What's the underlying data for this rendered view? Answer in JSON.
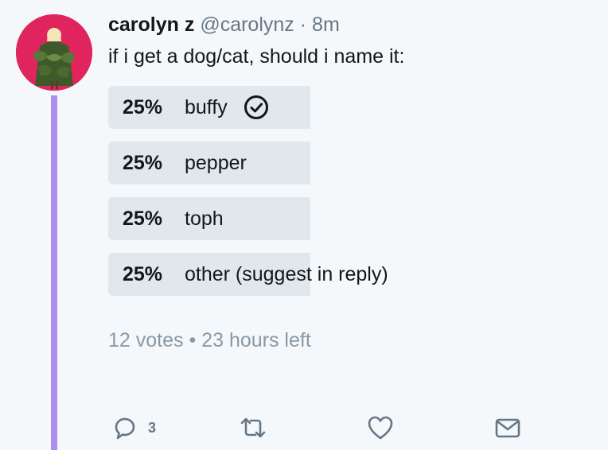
{
  "tweet": {
    "author_name": "carolyn z",
    "author_handle": "@carolynz",
    "separator": "·",
    "time": "8m",
    "text": "if i get a dog/cat, should i name it:"
  },
  "poll": {
    "options": [
      {
        "percent_label": "25%",
        "value": 0.25,
        "label": "buffy",
        "selected": true
      },
      {
        "percent_label": "25%",
        "value": 0.25,
        "label": "pepper",
        "selected": false
      },
      {
        "percent_label": "25%",
        "value": 0.25,
        "label": "toph",
        "selected": false
      },
      {
        "percent_label": "25%",
        "value": 0.25,
        "label": "other (suggest in reply)",
        "selected": false
      }
    ],
    "votes": "12 votes",
    "meta_separator": "•",
    "time_left": "23 hours left"
  },
  "actions": {
    "reply_icon": "reply-icon",
    "reply_count": "3",
    "retweet_icon": "retweet-icon",
    "like_icon": "heart-icon",
    "dm_icon": "envelope-icon"
  },
  "colors": {
    "thread_line": "#ad8eef",
    "poll_bar": "#e1e8ed",
    "muted_text": "#657786",
    "meta_text": "#8899a6",
    "icon": "#657786",
    "avatar_bg": "#e0245e"
  }
}
